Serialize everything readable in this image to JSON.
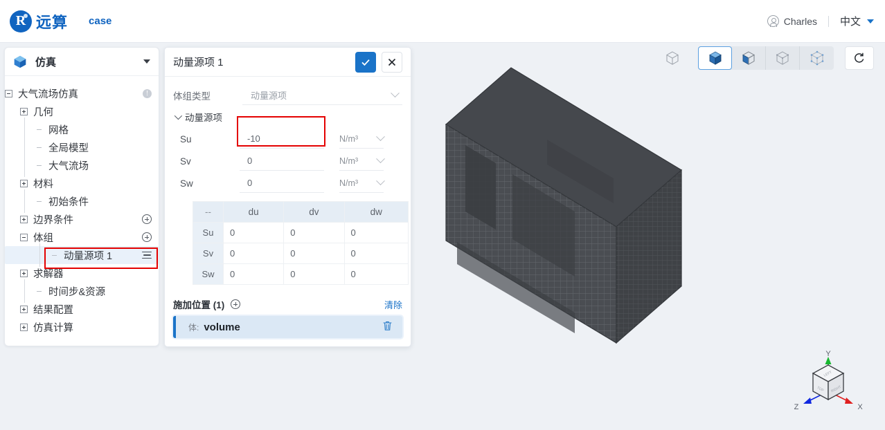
{
  "topbar": {
    "brand_glyph": "R",
    "brand_name": "远算",
    "case_label": "case",
    "user_name": "Charles",
    "divider": "|",
    "language": "中文",
    "avatar_icon": "user-circle-icon",
    "caret_icon": "caret-down-icon"
  },
  "sidebar": {
    "header": {
      "title": "仿真",
      "icon": "cube-icon",
      "caret": "caret-down-icon"
    },
    "tree": [
      {
        "label": "大气流场仿真",
        "level": 0,
        "expander": "minus",
        "trail": "info-badge"
      },
      {
        "label": "几何",
        "level": 1,
        "expander": "plus",
        "trail": ""
      },
      {
        "label": "网格",
        "level": 2,
        "expander": "stub",
        "trail": ""
      },
      {
        "label": "全局模型",
        "level": 2,
        "expander": "stub",
        "trail": ""
      },
      {
        "label": "大气流场",
        "level": 2,
        "expander": "stub",
        "trail": ""
      },
      {
        "label": "材料",
        "level": 1,
        "expander": "plus",
        "trail": ""
      },
      {
        "label": "初始条件",
        "level": 2,
        "expander": "stub",
        "trail": ""
      },
      {
        "label": "边界条件",
        "level": 1,
        "expander": "plus",
        "trail": "plus-circle"
      },
      {
        "label": "体组",
        "level": 1,
        "expander": "minus",
        "trail": "plus-circle"
      },
      {
        "label": "动量源项 1",
        "level": 3,
        "expander": "stub",
        "trail": "hamburger",
        "selected": true
      },
      {
        "label": "求解器",
        "level": 1,
        "expander": "plus",
        "trail": ""
      },
      {
        "label": "时间步&资源",
        "level": 2,
        "expander": "stub",
        "trail": ""
      },
      {
        "label": "结果配置",
        "level": 1,
        "expander": "plus",
        "trail": ""
      },
      {
        "label": "仿真计算",
        "level": 1,
        "expander": "plus",
        "trail": ""
      }
    ]
  },
  "panel": {
    "title": "动量源项 1",
    "confirm_icon": "check-icon",
    "cancel_icon": "close-icon",
    "type_field": {
      "label": "体组类型",
      "value": "动量源项",
      "chevron": "chevron-down-icon"
    },
    "section": {
      "label": "动量源项",
      "chevron": "chevron-down-icon"
    },
    "source_rows": [
      {
        "label": "Su",
        "value": "-10",
        "unit": "N/m³"
      },
      {
        "label": "Sv",
        "value": "0",
        "unit": "N/m³"
      },
      {
        "label": "Sw",
        "value": "0",
        "unit": "N/m³"
      }
    ],
    "matrix": {
      "headers": [
        "--",
        "du",
        "dv",
        "dw"
      ],
      "rows": [
        {
          "name": "Su",
          "values": [
            "0",
            "0",
            "0"
          ]
        },
        {
          "name": "Sv",
          "values": [
            "0",
            "0",
            "0"
          ]
        },
        {
          "name": "Sw",
          "values": [
            "0",
            "0",
            "0"
          ]
        }
      ]
    },
    "location": {
      "title": "施加位置 (1)",
      "add_icon": "plus-circle-icon",
      "clear_label": "清除",
      "item": {
        "kind": "体:",
        "name": "volume",
        "delete_icon": "trash-icon"
      }
    }
  },
  "viewport": {
    "toolbar": {
      "standalone_icon": "cube-outline-icon",
      "modes": [
        {
          "icon": "cube-solid-icon",
          "active": true
        },
        {
          "icon": "cube-half-solid-icon",
          "active": false
        },
        {
          "icon": "cube-wire-icon",
          "active": false
        },
        {
          "icon": "cube-points-icon",
          "active": false
        }
      ],
      "reset_icon": "reset-view-icon"
    },
    "gizmo": {
      "axis_x": "X",
      "axis_y": "Y",
      "axis_z": "Z",
      "face_top": "TOP",
      "face_left": "LEFT",
      "face_right": "RIGHT",
      "color_x": "#e02020",
      "color_y": "#18b830",
      "color_z": "#1028e0"
    },
    "mesh_color": "#4a4d52",
    "background": "#eef1f5"
  },
  "annotations": [
    {
      "name": "su-input-highlight"
    },
    {
      "name": "tree-item-highlight"
    }
  ]
}
